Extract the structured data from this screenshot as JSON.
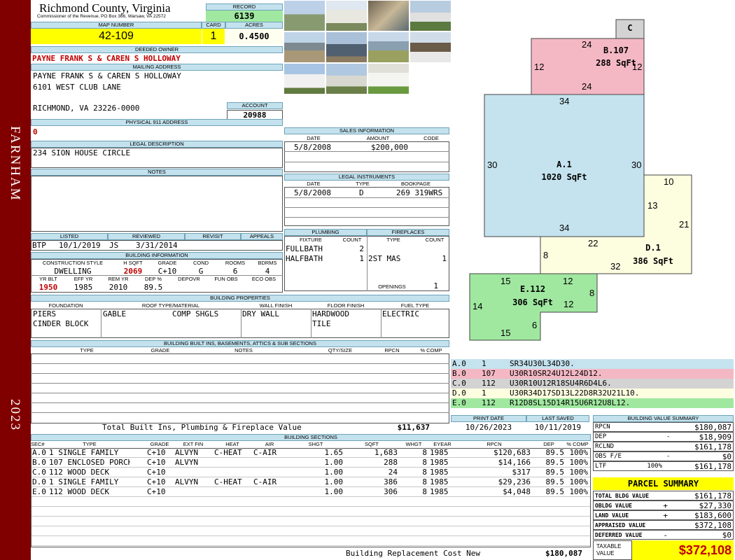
{
  "sidebar": {
    "location": "FARNHAM",
    "year": "2023"
  },
  "header": {
    "county": "Richmond County, Virginia",
    "address": "Commissioner of the Revenue, PO Box 366, Warsaw, VA 22572",
    "record_label": "RECORD",
    "record": "6139",
    "map_label": "MAP NUMBER",
    "map_number": "42-109",
    "card_label": "CARD",
    "card": "1",
    "acres_label": "ACRES",
    "acres": "0.4500"
  },
  "owner": {
    "label": "DEEDED OWNER",
    "name": "PAYNE FRANK S & CAREN S HOLLOWAY",
    "mail_label": "MAILING ADDRESS",
    "mail_line1": "PAYNE FRANK S & CAREN S HOLLOWAY",
    "mail_line2": "6101 WEST CLUB LANE",
    "mail_line3": "RICHMOND, VA 23226-0000",
    "account_label": "ACCOUNT",
    "account": "20988",
    "phys_label": "PHYSICAL 911 ADDRESS",
    "phys": "0",
    "legal_label": "LEGAL DESCRIPTION",
    "legal": "234 SION HOUSE CIRCLE",
    "notes_label": "NOTES"
  },
  "sales": {
    "label": "SALES INFORMATION",
    "h_date": "DATE",
    "h_amount": "AMOUNT",
    "h_code": "CODE",
    "date": "5/8/2008",
    "amount": "$200,000"
  },
  "legal_inst": {
    "label": "LEGAL INSTRUMENTS",
    "h_date": "DATE",
    "h_type": "TYPE",
    "h_book": "BOOKPAGE",
    "date": "5/8/2008",
    "type": "D",
    "book": "269 319WRS"
  },
  "listing": {
    "h_listed": "LISTED",
    "h_reviewed": "REVIEWED",
    "h_revisit": "REVISIT",
    "h_appeals": "APPEALS",
    "listed_by": "BTP",
    "listed": "10/1/2019",
    "rev_by": "JS",
    "reviewed": "3/31/2014"
  },
  "bldg_info": {
    "label": "BUILDING INFORMATION",
    "h_style": "CONSTRUCTION STYLE",
    "h_hsqft": "H SQFT",
    "h_grade": "GRADE",
    "h_cond": "COND",
    "h_rooms": "ROOMS",
    "h_bdrms": "BDRMS",
    "style": "DWELLING",
    "hsqft": "2069",
    "grade": "C+10",
    "cond": "G",
    "rooms": "6",
    "bdrms": "4",
    "h_yrblt": "YR BLT",
    "h_effyr": "EFF YR",
    "h_remyr": "REM YR",
    "h_dep": "DEP %",
    "h_depovr": "DEPOVR",
    "h_funobs": "FUN OBS",
    "h_ecoobs": "ECO OBS",
    "yrblt": "1950",
    "effyr": "1985",
    "remyr": "2010",
    "dep": "89.5"
  },
  "plumbing": {
    "label": "PLUMBING",
    "h_fixture": "FIXTURE",
    "h_count": "COUNT",
    "f1": "FULLBATH",
    "c1": "2",
    "f2": "HALFBATH",
    "c2": "1"
  },
  "fireplaces": {
    "label": "FIREPLACES",
    "h_type": "TYPE",
    "h_count": "COUNT",
    "t1": "2ST MAS",
    "c1": "1",
    "openings_label": "OPENINGS",
    "openings": "1"
  },
  "props": {
    "label": "BUILDING PROPERTIES",
    "h_foundation": "FOUNDATION",
    "h_roof": "ROOF TYPE/MATERIAL",
    "h_wall": "WALL FINISH",
    "h_floor": "FLOOR FINISH",
    "h_fuel": "FUEL TYPE",
    "foundation1": "PIERS",
    "foundation2": "CINDER BLOCK",
    "roof_type": "GABLE",
    "roof_mat": "COMP SHGLS",
    "wall": "DRY WALL",
    "floor1": "HARDWOOD",
    "floor2": "TILE",
    "fuel": "ELECTRIC"
  },
  "builtins": {
    "label": "BUILDING BUILT INS, BASEMENTS, ATTICS & SUB SECTIONS",
    "h_type": "TYPE",
    "h_grade": "GRADE",
    "h_notes": "NOTES",
    "h_qty": "QTY/SIZE",
    "h_rpcn": "RPCN",
    "h_comp": "% COMP",
    "total_label": "Total Built Ins, Plumbing & Fireplace Value",
    "total": "$11,637"
  },
  "sketch": {
    "sections": [
      {
        "code": "A.0",
        "seg": "1",
        "path": "SR34U30L34D30.",
        "color": "#c5e3ef"
      },
      {
        "code": "B.0",
        "seg": "107",
        "path": "U30R10SR24U12L24D12.",
        "color": "#f4b8c4"
      },
      {
        "code": "C.0",
        "seg": "112",
        "path": "U30R10U12R18SU4R6D4L6.",
        "color": "#d3d3d3"
      },
      {
        "code": "D.0",
        "seg": "1",
        "path": "U30R34D17SD13L22D8R32U21L10.",
        "color": "#fdfde0"
      },
      {
        "code": "E.0",
        "seg": "112",
        "path": "R12D8SL15D14R15U6R12U8L12.",
        "color": "#a0e8a0"
      }
    ],
    "labels": {
      "a_name": "A.1",
      "a_area": "1020 SqFt",
      "b_name": "B.107",
      "b_area": "288 SqFt",
      "c_name": "C",
      "d_name": "D.1",
      "d_area": "386 SqFt",
      "e_name": "E.112",
      "e_area": "306 SqFt"
    },
    "dims": {
      "a_top": "34",
      "a_bottom": "34",
      "a_left": "30",
      "a_right": "30",
      "b_top": "24",
      "b_bottom": "24",
      "b_left": "12",
      "b_right": "12",
      "d_10": "10",
      "d_13": "13",
      "d_21": "21",
      "d_22": "22",
      "d_8": "8",
      "d_32": "32",
      "e_15a": "15",
      "e_12a": "12",
      "e_8": "8",
      "e_14": "14",
      "e_12b": "12",
      "e_6": "6",
      "e_15b": "15"
    }
  },
  "dates": {
    "print_label": "PRINT DATE",
    "print": "10/26/2023",
    "saved_label": "LAST SAVED",
    "saved": "10/11/2019"
  },
  "sections": {
    "label": "BUILDING SECTIONS",
    "headers": [
      "SEC#",
      "TYPE",
      "GRADE",
      "EXT FIN",
      "HEAT",
      "AIR",
      "SHGT",
      "SQFT",
      "WHGT",
      "EYEAR",
      "RPCN",
      "DEP",
      "% COMP"
    ],
    "rows": [
      [
        "A.0",
        "1 SINGLE FAMILY",
        "C+10",
        "ALVYN",
        "C-HEAT",
        "C-AIR",
        "1.65",
        "1,683",
        "8",
        "1985",
        "$120,683",
        "89.5",
        "100%"
      ],
      [
        "B.0",
        "107 ENCLOSED PORCH",
        "C+10",
        "ALVYN",
        "",
        "",
        "1.00",
        "288",
        "8",
        "1985",
        "$14,166",
        "89.5",
        "100%"
      ],
      [
        "C.0",
        "112 WOOD DECK",
        "C+10",
        "",
        "",
        "",
        "1.00",
        "24",
        "8",
        "1985",
        "$317",
        "89.5",
        "100%"
      ],
      [
        "D.0",
        "1 SINGLE FAMILY",
        "C+10",
        "ALVYN",
        "C-HEAT",
        "C-AIR",
        "1.00",
        "386",
        "8",
        "1985",
        "$29,236",
        "89.5",
        "100%"
      ],
      [
        "E.0",
        "112 WOOD DECK",
        "C+10",
        "",
        "",
        "",
        "1.00",
        "306",
        "8",
        "1985",
        "$4,048",
        "89.5",
        "100%"
      ]
    ],
    "replacement_label": "Building Replacement Cost New",
    "replacement": "$180,087"
  },
  "value_summary": {
    "label": "BUILDING VALUE SUMMARY",
    "rows": [
      {
        "name": "RPCN",
        "sign": "",
        "pct": "",
        "value": "$180,087"
      },
      {
        "name": "DEP",
        "sign": "-",
        "pct": "",
        "value": "$18,909"
      },
      {
        "name": "RCLND",
        "sign": "",
        "pct": "",
        "value": "$161,178"
      },
      {
        "name": "OBS F/E",
        "sign": "-",
        "pct": "",
        "value": "$0"
      },
      {
        "name": "LTF",
        "sign": "",
        "pct": "100%",
        "value": "$161,178"
      }
    ]
  },
  "parcel": {
    "label": "PARCEL SUMMARY",
    "rows": [
      {
        "name": "TOTAL BLDG VALUE",
        "sign": "",
        "value": "$161,178"
      },
      {
        "name": "OBLDG VALUE",
        "sign": "+",
        "value": "$27,330"
      },
      {
        "name": "LAND VALUE",
        "sign": "+",
        "value": "$183,600"
      },
      {
        "name": "APPRAISED VALUE",
        "sign": "",
        "value": "$372,108"
      },
      {
        "name": "DEFERRED VALUE",
        "sign": "-",
        "value": "$0"
      }
    ],
    "taxable_label1": "TAXABLE",
    "taxable_label2": "VALUE",
    "taxable": "$372,108"
  }
}
